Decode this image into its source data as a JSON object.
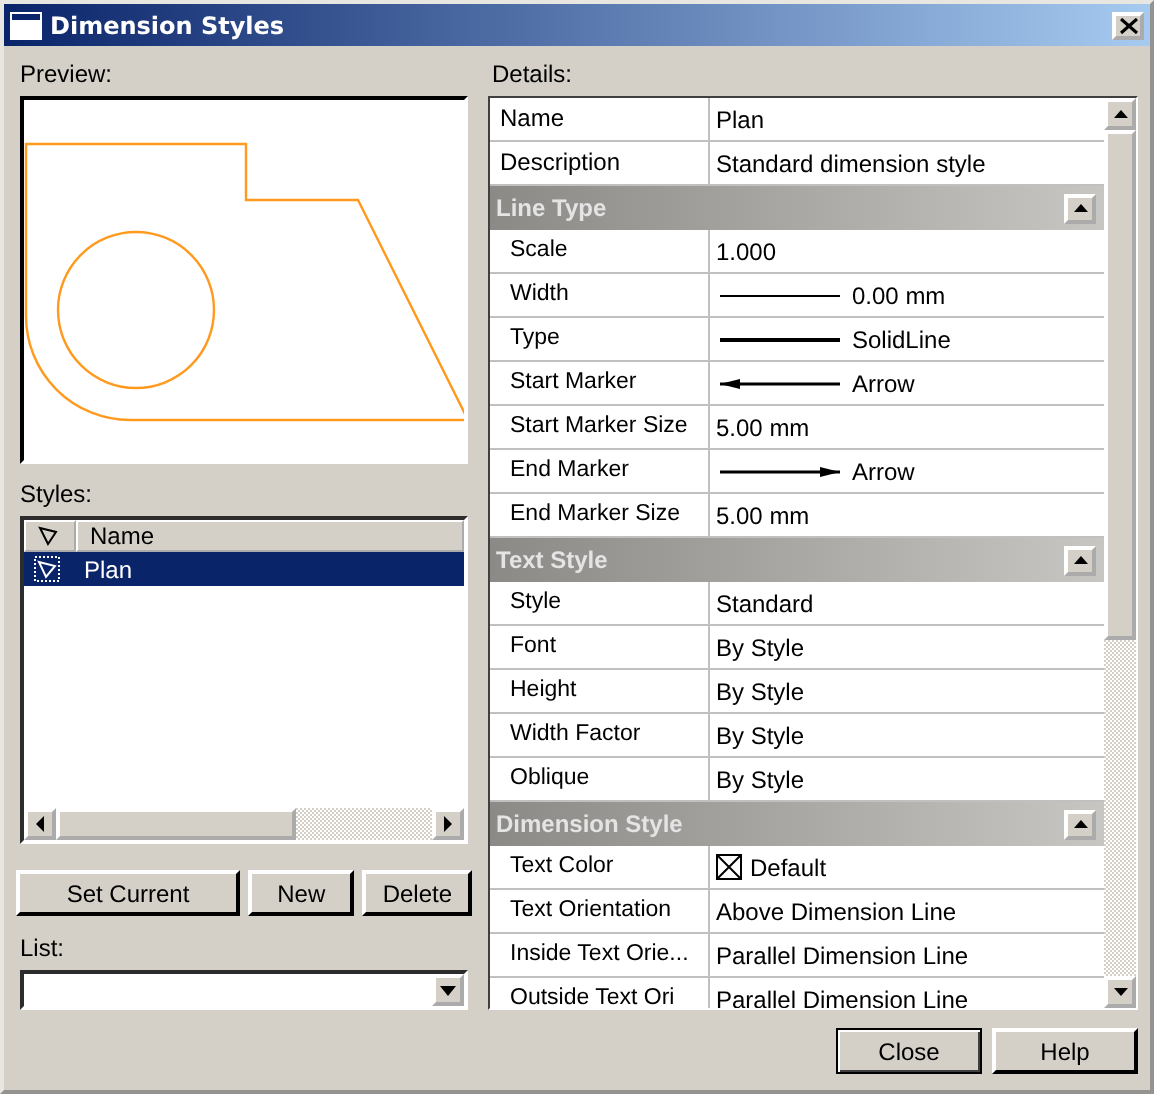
{
  "window": {
    "title": "Dimension Styles"
  },
  "preview": {
    "label": "Preview:"
  },
  "styles": {
    "label": "Styles:",
    "columns": [
      "Name"
    ],
    "rows": [
      {
        "name": "Plan",
        "selected": true
      }
    ]
  },
  "style_buttons": [
    "Set Current",
    "New",
    "Delete"
  ],
  "list": {
    "label": "List:"
  },
  "details": {
    "label": "Details:",
    "items": [
      {
        "kind": "row",
        "name": "Name",
        "value": "Plan"
      },
      {
        "kind": "row",
        "name": "Description",
        "value": "Standard dimension style"
      },
      {
        "kind": "section",
        "name": "Line Type",
        "expanded": true,
        "children": [
          {
            "kind": "row",
            "name": "Scale",
            "value": "1.000"
          },
          {
            "kind": "thin-line",
            "name": "Width",
            "value": "0.00 mm"
          },
          {
            "kind": "thick-line",
            "name": "Type",
            "value": "SolidLine"
          },
          {
            "kind": "start-arrow",
            "name": "Start Marker",
            "value": "Arrow"
          },
          {
            "kind": "row",
            "name": "Start Marker Size",
            "value": "5.00 mm"
          },
          {
            "kind": "end-arrow",
            "name": "End Marker",
            "value": "Arrow"
          },
          {
            "kind": "row",
            "name": "End Marker Size",
            "value": "5.00 mm"
          }
        ]
      },
      {
        "kind": "section",
        "name": "Text Style",
        "expanded": true,
        "children": [
          {
            "kind": "row",
            "name": "Style",
            "value": "Standard"
          },
          {
            "kind": "row",
            "name": "Font",
            "value": "By Style"
          },
          {
            "kind": "row",
            "name": "Height",
            "value": "By Style"
          },
          {
            "kind": "row",
            "name": "Width Factor",
            "value": "By Style"
          },
          {
            "kind": "row",
            "name": "Oblique",
            "value": "By Style"
          }
        ]
      },
      {
        "kind": "section",
        "name": "Dimension Style",
        "expanded": true,
        "children": [
          {
            "kind": "color",
            "name": "Text Color",
            "value": "Default"
          },
          {
            "kind": "row",
            "name": "Text Orientation",
            "value": "Above Dimension Line"
          },
          {
            "kind": "row",
            "name": "Inside Text Orie...",
            "value": "Parallel Dimension Line"
          },
          {
            "kind": "row",
            "name": "Outside Text Ori",
            "value": "Parallel Dimension Line"
          }
        ]
      }
    ]
  },
  "buttons": [
    "Close",
    "Help"
  ]
}
